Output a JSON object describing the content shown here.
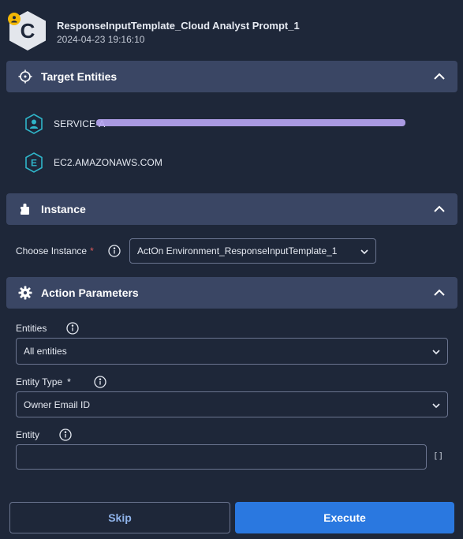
{
  "header": {
    "avatar_letter": "C",
    "title": "ResponseInputTemplate_Cloud Analyst Prompt_1",
    "timestamp": "2024-04-23 19:16:10",
    "avatar_color": "#e3e6ec",
    "user_badge_color": "#f2b705"
  },
  "sections": {
    "target_entities": {
      "label": "Target Entities",
      "icon": "crosshair-icon"
    },
    "instance": {
      "label": "Instance",
      "icon": "puzzle-icon"
    },
    "action_parameters": {
      "label": "Action Parameters",
      "icon": "gear-icon"
    }
  },
  "entities": [
    {
      "icon": "user-entity-icon",
      "letter": "",
      "label": "SERVICE-A"
    },
    {
      "icon": "e-entity-icon",
      "letter": "E",
      "label": "EC2.AMAZONAWS.COM"
    }
  ],
  "instance": {
    "label": "Choose Instance",
    "required_mark": "*",
    "selected": "ActOn Environment_ResponseInputTemplate_1"
  },
  "parameters": {
    "entities": {
      "label": "Entities",
      "selected": "All entities"
    },
    "entity_type": {
      "label": "Entity Type",
      "required_mark": "*",
      "selected": "Owner Email ID"
    },
    "entity": {
      "label": "Entity",
      "value": "",
      "list_icon": "[]"
    }
  },
  "buttons": {
    "skip": "Skip",
    "execute": "Execute"
  },
  "colors": {
    "background": "#1e2739",
    "section_bar": "#3a4664",
    "accent": "#2a78e0",
    "required": "#e05b5b"
  }
}
